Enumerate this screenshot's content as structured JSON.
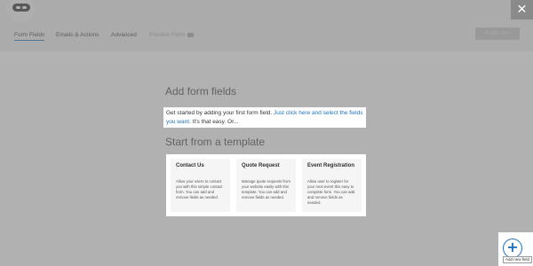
{
  "header": {
    "close_label": "✕",
    "tabs": [
      {
        "label": "Form Fields",
        "active": true
      },
      {
        "label": "Emails & Actions",
        "active": false
      },
      {
        "label": "Advanced",
        "active": false
      },
      {
        "label": "Preview Form",
        "active": false,
        "disabled": true
      }
    ],
    "publish_label": "PUBLISH"
  },
  "main": {
    "heading": "Add form fields",
    "intro_text": "Get started by adding your first form field.",
    "intro_link": "Just click here and select the fields you want.",
    "intro_tail": "It's that easy. Or...",
    "template_heading": "Start from a template",
    "templates": [
      {
        "title": "Contact Us",
        "description": "Allow your users to contact you with this simple contact form. You can add and remove fields as needed."
      },
      {
        "title": "Quote Request",
        "description": "Manage quote requests from your website easily with this template. You can add and remove fields as needed."
      },
      {
        "title": "Event Registration",
        "description": "Allow user to register for your next event this easy to complete form. You can add and remove fields as needed."
      }
    ]
  },
  "fab": {
    "icon": "plus-icon",
    "tooltip": "Add new field"
  },
  "colors": {
    "accent": "#1e73be",
    "overlay": "#787878"
  }
}
